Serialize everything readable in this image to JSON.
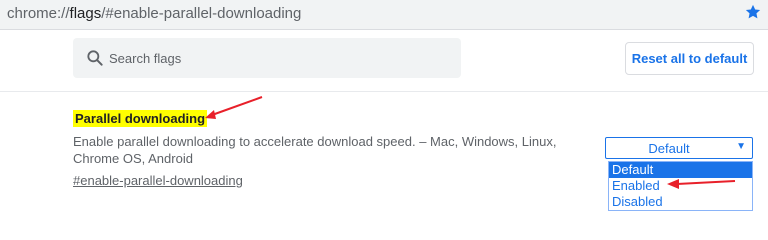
{
  "address_bar": {
    "scheme": "chrome://",
    "host": "flags",
    "path": "/#enable-parallel-downloading",
    "bookmark_icon": "star-icon"
  },
  "search": {
    "placeholder": "Search flags",
    "icon": "search-icon"
  },
  "reset_button": {
    "label": "Reset all to default"
  },
  "flag": {
    "title": "Parallel downloading",
    "description": "Enable parallel downloading to accelerate download speed. – Mac, Windows, Linux, Chrome OS, Android",
    "link": "#enable-parallel-downloading",
    "select": {
      "selected": "Default",
      "options": [
        "Default",
        "Enabled",
        "Disabled"
      ]
    }
  },
  "colors": {
    "accent": "#1a73e8",
    "highlight": "#ffff00",
    "annotation_arrow": "#e8202a"
  }
}
